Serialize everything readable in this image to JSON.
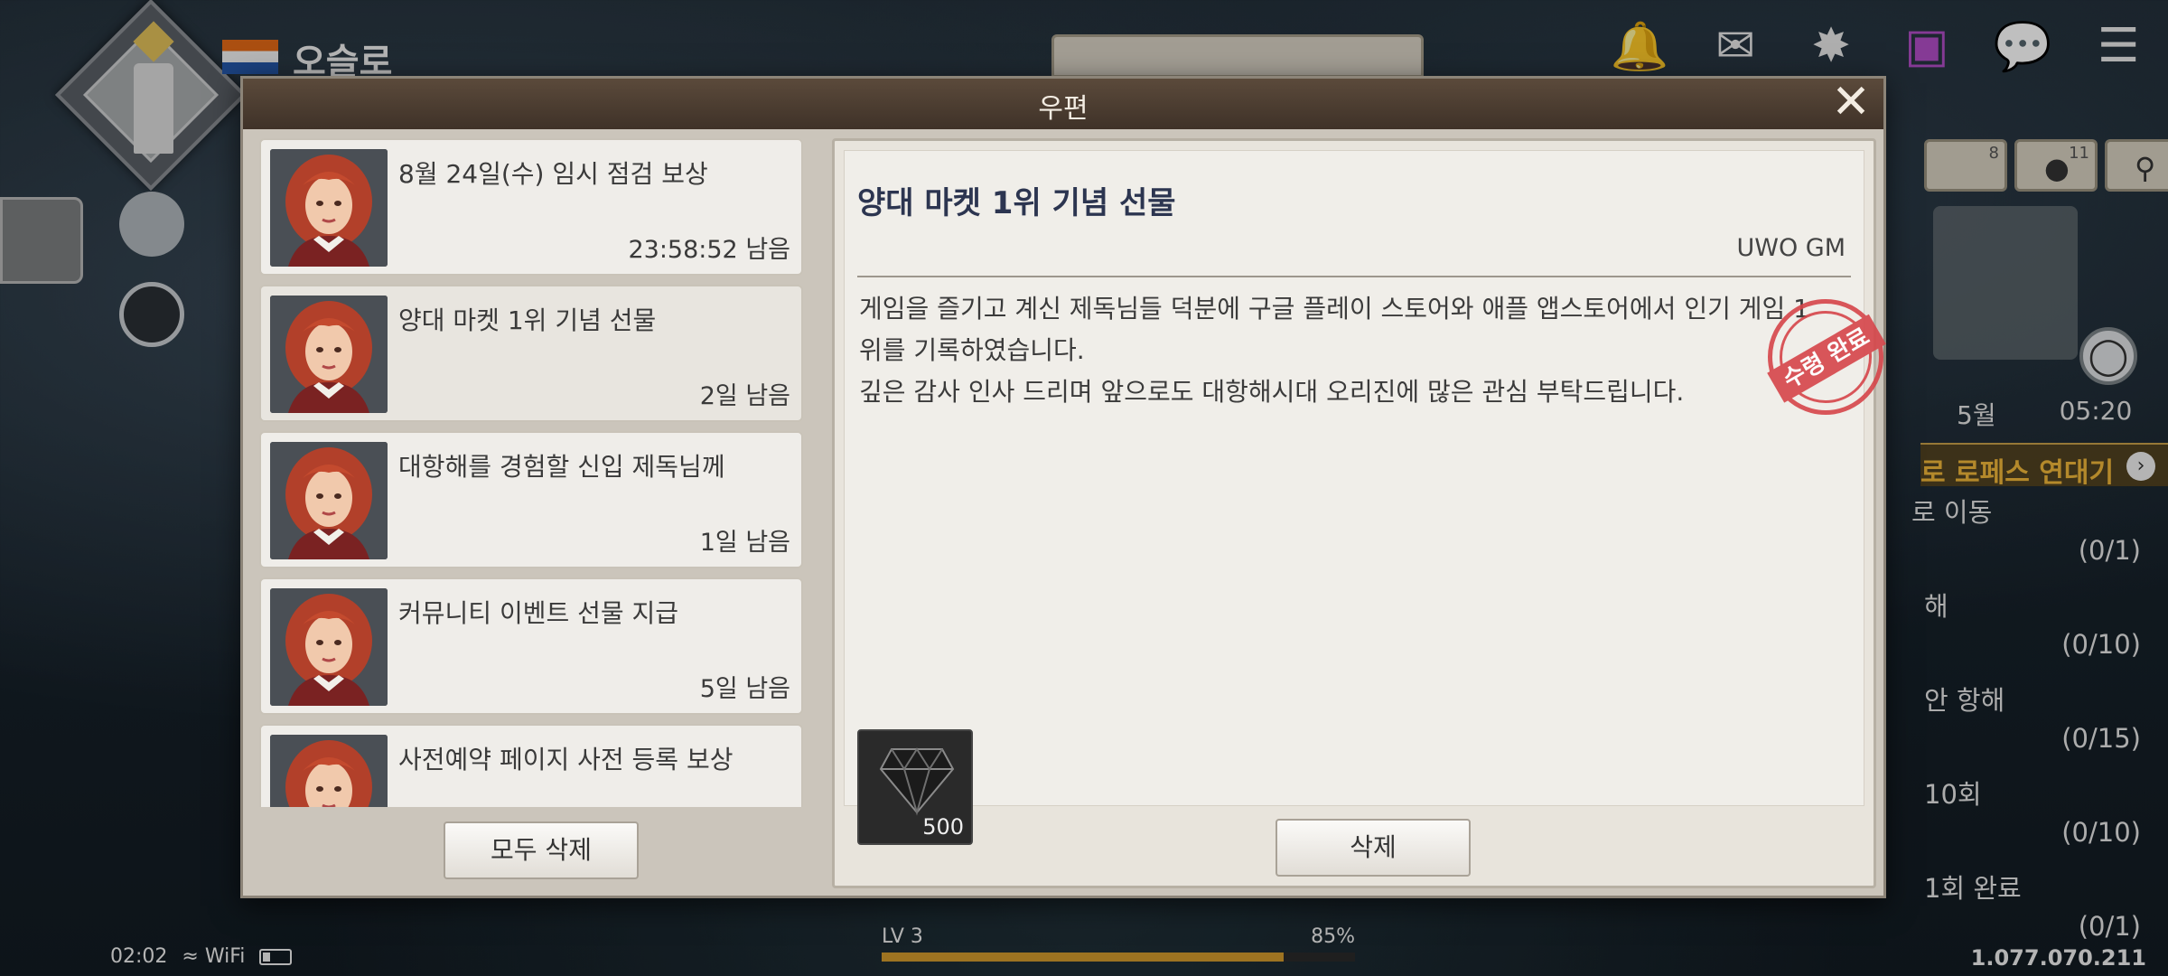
{
  "hud": {
    "city_name": "오슬로",
    "time_row": {
      "month": "5월",
      "time": "05:20"
    },
    "quest_header": "로 로페스 연대기",
    "quests": [
      {
        "text": "로 이동",
        "count": "(0/1)"
      },
      {
        "text": "해",
        "count": "(0/10)"
      },
      {
        "text": "안 항해",
        "count": "(0/15)"
      },
      {
        "text": "10회",
        "count": "(0/10)"
      },
      {
        "text": "1회 완료",
        "count": "(0/1)"
      }
    ],
    "counters": [
      "8",
      "11"
    ],
    "status": {
      "clock": "02:02",
      "wifi": "WiFi"
    },
    "xp": {
      "level": "LV 3",
      "percent_label": "85%",
      "fill": 0.85
    },
    "gold": "1.077.070.211"
  },
  "modal": {
    "title": "우편",
    "close": "✕",
    "mails": [
      {
        "title": "8월 24일(수) 임시 점검 보상",
        "remain": "23:58:52 남음"
      },
      {
        "title": "양대 마켓 1위 기념 선물",
        "remain": "2일 남음"
      },
      {
        "title": "대항해를 경험할 신입 제독님께",
        "remain": "1일 남음"
      },
      {
        "title": "커뮤니티 이벤트 선물 지급",
        "remain": "5일 남음"
      },
      {
        "title": "사전예약 페이지 사전 등록 보상",
        "remain": ""
      }
    ],
    "delete_all_label": "모두 삭제",
    "detail": {
      "subject": "양대 마켓 1위 기념 선물",
      "sender": "UWO GM",
      "body_line1": "게임을 즐기고 계신 제독님들 덕분에 구글 플레이 스토어와 애플 앱스토어에서 인기 게임 1",
      "body_line2": "위를 기록하였습니다.",
      "body_line3": "깊은 감사 인사 드리며 앞으로도 대항해시대 오리진에 많은 관심 부탁드립니다.",
      "stamp": "수령 완료",
      "attachment": {
        "icon": "diamond-gem-icon",
        "qty": "500"
      },
      "delete_label": "삭제"
    }
  },
  "colors": {
    "header_brown": "#4d3e32",
    "subject_navy": "#2c3550",
    "stamp_red": "#d6454a",
    "quest_gold": "#f0b73a"
  }
}
